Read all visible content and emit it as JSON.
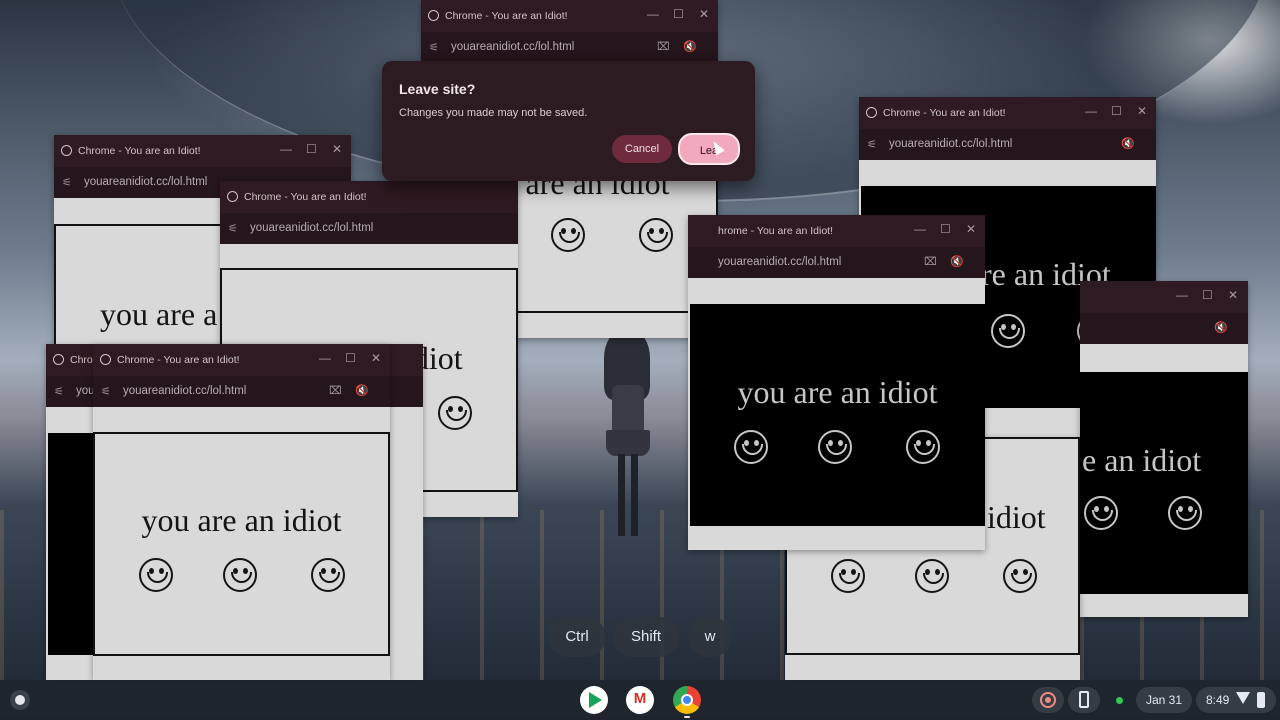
{
  "window_title": "Chrome - You are an Idiot!",
  "url": "youareanidiot.cc/lol.html",
  "page_message": "you are an idiot",
  "partial_texts": {
    "w2_message": "you are a",
    "w3_message": "n idiot",
    "w4_title": "Chron",
    "w4_url": "you",
    "w7_title": "hrome - You are an Idiot!",
    "w7_url": "youareanidiot.cc/lol.html",
    "w8_message": "e an idiot",
    "w9_message": "e an idiot",
    "w10_message": "idiot",
    "w6_message": "re an idiot"
  },
  "dialog": {
    "title": "Leave site?",
    "message": "Changes you made may not be saved.",
    "cancel_label": "Cancel",
    "leave_label": "Lea"
  },
  "keys": [
    "Ctrl",
    "Shift",
    "w"
  ],
  "window_controls": {
    "minimize": "—",
    "maximize": "☐",
    "close": "✕"
  },
  "icons": {
    "tune": "tune-icon",
    "camera_off": "camera-off-icon",
    "muted": "volume-off-icon"
  },
  "shelf": {
    "apps": [
      "play-store-icon",
      "gmail-icon",
      "chrome-icon"
    ],
    "date": "Jan 31",
    "time": "8:49"
  },
  "colors": {
    "titlebar": "#2e1a22",
    "dialog_bg": "#2c1c22",
    "leave_button": "#f3a9bd",
    "cancel_button": "#6e2b3e"
  }
}
